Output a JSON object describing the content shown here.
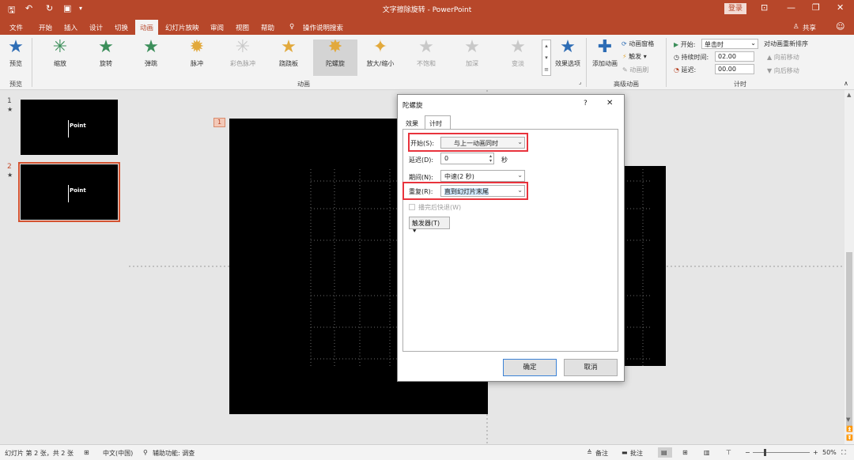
{
  "window": {
    "title": "文字擦除旋转 - PowerPoint",
    "login": "登录",
    "share": "共享"
  },
  "tabs": [
    "文件",
    "开始",
    "插入",
    "设计",
    "切换",
    "动画",
    "幻灯片放映",
    "审阅",
    "视图",
    "帮助",
    "操作说明搜索"
  ],
  "active_tab": "动画",
  "ribbon": {
    "preview": "预览",
    "preview_group": "预览",
    "effects": [
      "缩放",
      "旋转",
      "弹跳",
      "脉冲",
      "彩色脉冲",
      "跷跷板",
      "陀螺旋",
      "放大/缩小",
      "不饱和",
      "加深",
      "变淡"
    ],
    "animation_group": "动画",
    "effect_options": "效果选项",
    "add_animation": "添加动画",
    "animation_pane": "动画窗格",
    "trigger": "触发",
    "animation_painter": "动画刷",
    "advanced_group": "高级动画",
    "start_label": "开始:",
    "start_value": "单击时",
    "duration_label": "持续时间:",
    "duration_value": "02.00",
    "delay_label": "延迟:",
    "delay_value": "00.00",
    "reorder_label": "对动画重新排序",
    "move_earlier": "向前移动",
    "move_later": "向后移动",
    "timing_group": "计时"
  },
  "slides": [
    {
      "num": "1",
      "star": "★",
      "text": "Point"
    },
    {
      "num": "2",
      "star": "★",
      "text": "Point"
    }
  ],
  "canvas": {
    "badge": "1"
  },
  "dialog": {
    "title": "陀螺旋",
    "help": "?",
    "close": "✕",
    "tabs": [
      "效果",
      "计时"
    ],
    "start_label": "开始(S):",
    "start_value": "与上一动画同时",
    "delay_label": "延迟(D):",
    "delay_value": "0",
    "delay_unit": "秒",
    "period_label": "期间(N):",
    "period_value": "中速(2 秒)",
    "repeat_label": "重复(R):",
    "repeat_value": "直到幻灯片末尾",
    "rewind_label": "播完后快退(W)",
    "trigger_btn": "触发器(T)",
    "ok": "确定",
    "cancel": "取消"
  },
  "status": {
    "slide": "幻灯片 第 2 张，共 2 张",
    "language": "中文(中国)",
    "accessibility": "辅助功能: 调查",
    "notes": "备注",
    "comments": "批注",
    "zoom": "50%"
  },
  "colors": {
    "accent": "#b7472a",
    "highlight": "#e8333c"
  }
}
